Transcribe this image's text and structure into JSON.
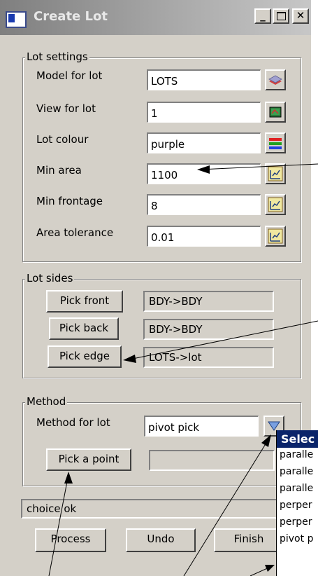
{
  "window": {
    "title": "Create Lot"
  },
  "groups": {
    "lot_settings": {
      "label": "Lot settings",
      "fields": [
        {
          "label": "Model for lot",
          "value": "LOTS",
          "icon": "layers-icon"
        },
        {
          "label": "View for lot",
          "value": "1",
          "icon": "view-icon"
        },
        {
          "label": "Lot colour",
          "value": "purple",
          "icon": "colour-icon"
        },
        {
          "label": "Min area",
          "value": "1100",
          "icon": "calculator-icon"
        },
        {
          "label": "Min frontage",
          "value": "8",
          "icon": "calculator-icon"
        },
        {
          "label": "Area tolerance",
          "value": "0.01",
          "icon": "calculator-icon"
        }
      ]
    },
    "lot_sides": {
      "label": "Lot sides",
      "rows": [
        {
          "button": "Pick front",
          "value": "BDY->BDY"
        },
        {
          "button": "Pick back",
          "value": "BDY->BDY"
        },
        {
          "button": "Pick edge",
          "value": "LOTS->lot"
        }
      ]
    },
    "method": {
      "label": "Method",
      "method_label": "Method for lot",
      "method_value": "pivot pick",
      "pick_point_button": "Pick a point",
      "pick_point_value": ""
    }
  },
  "status": "choice ok",
  "buttons": {
    "process": "Process",
    "undo": "Undo",
    "finish": "Finish"
  },
  "dropdown": {
    "header": "Selec",
    "items": [
      "paralle",
      "paralle",
      "paralle",
      "perper",
      "perper",
      "pivot p"
    ]
  },
  "colors": {
    "dropdown_header": "#0a246a",
    "window_bg": "#d4d0c8"
  }
}
